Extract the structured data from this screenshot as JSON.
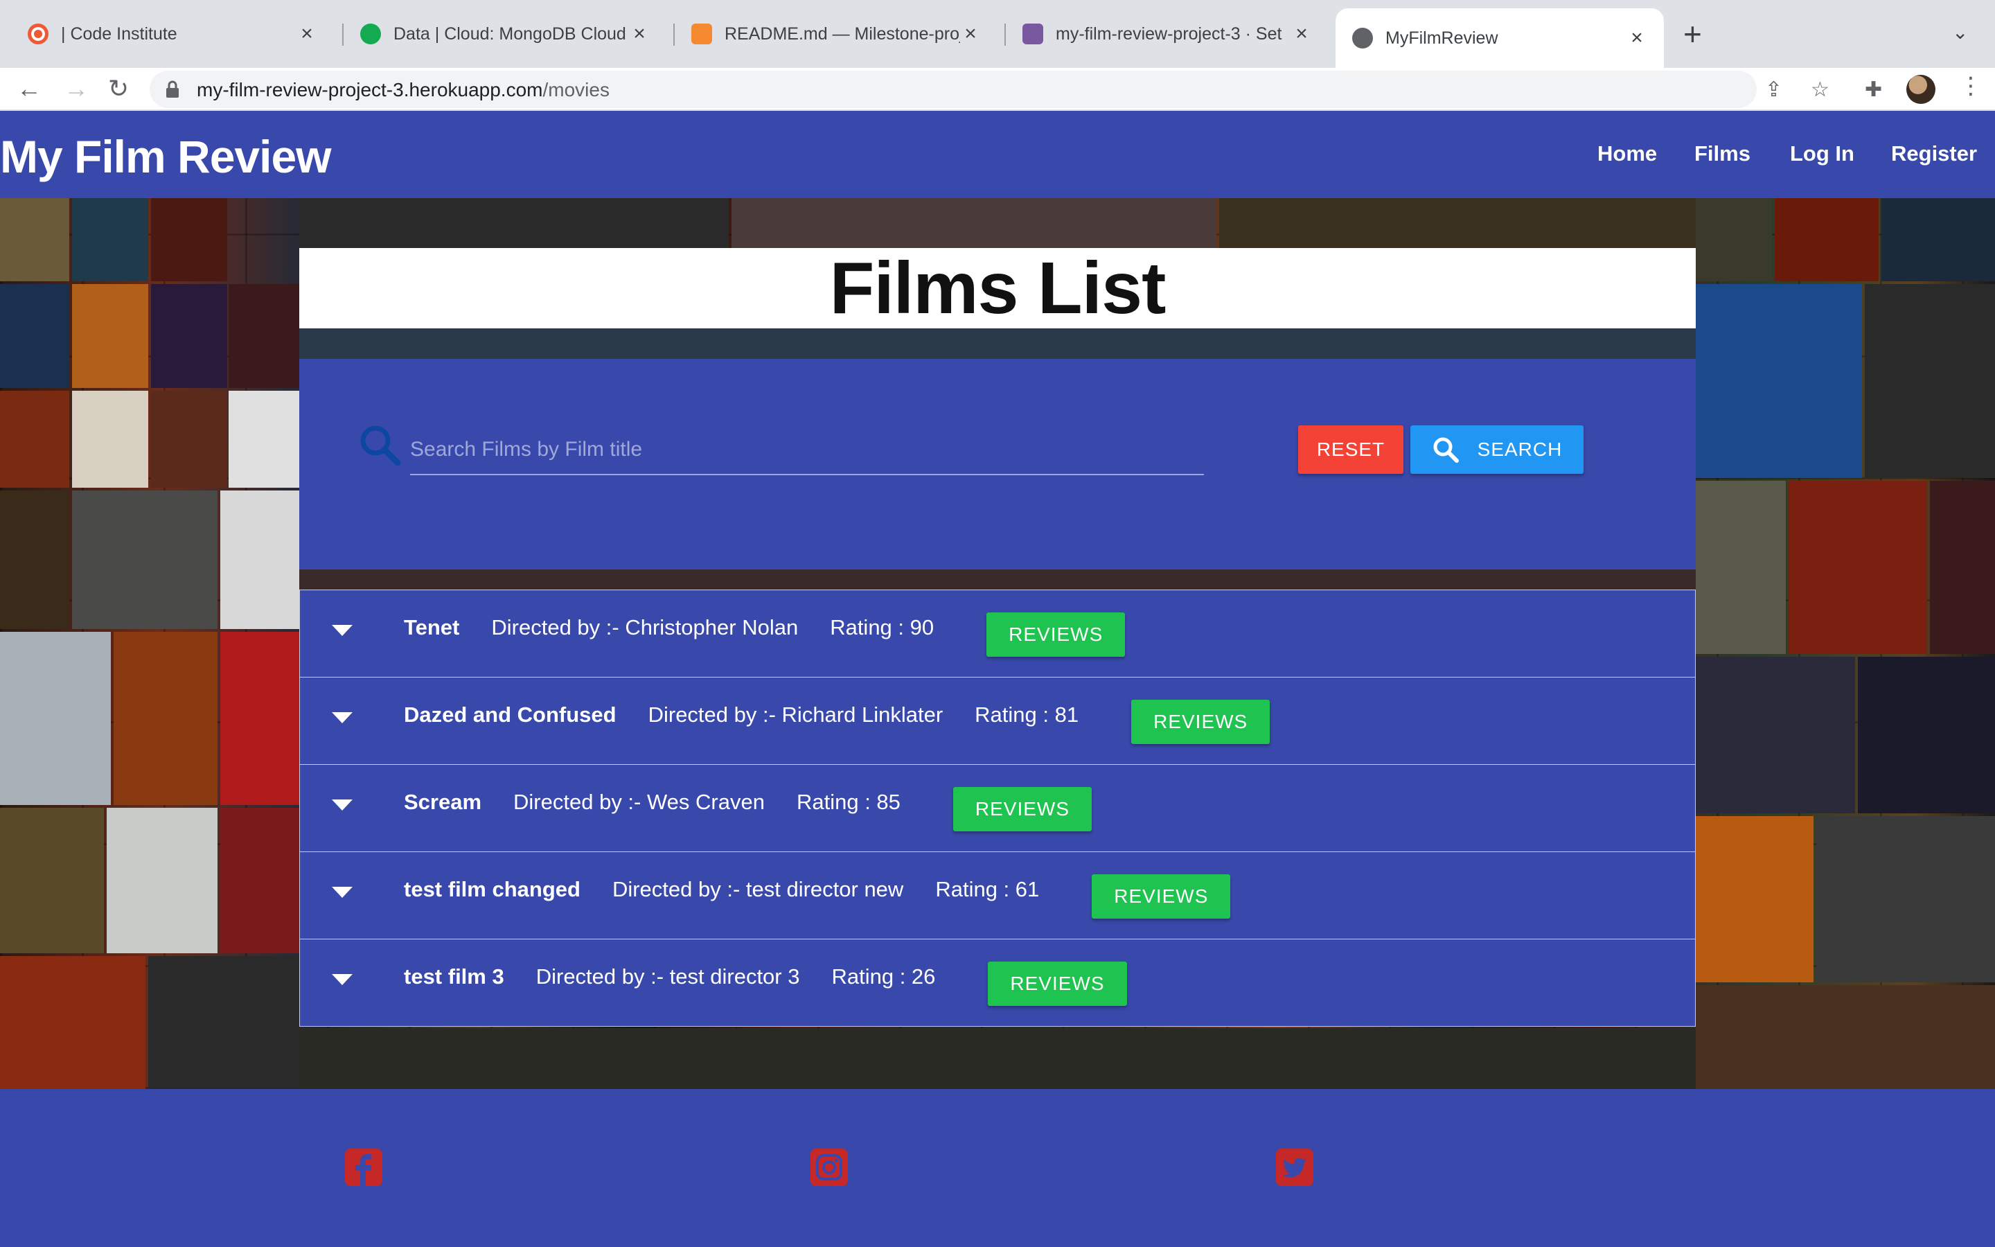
{
  "browser": {
    "tabs": [
      {
        "title": "| Code Institute",
        "active": false
      },
      {
        "title": "Data | Cloud: MongoDB Cloud",
        "active": false
      },
      {
        "title": "README.md — Milestone-proje",
        "active": false
      },
      {
        "title": "my-film-review-project-3 · Set",
        "active": false
      },
      {
        "title": "MyFilmReview",
        "active": true
      }
    ],
    "url_host": "my-film-review-project-3.herokuapp.com",
    "url_path": "/movies"
  },
  "site": {
    "brand": "My Film Review",
    "nav": {
      "home": "Home",
      "films": "Films",
      "login": "Log In",
      "register": "Register"
    }
  },
  "page": {
    "title": "Films List",
    "search": {
      "placeholder": "Search Films by Film title",
      "value": ""
    },
    "reset_label": "RESET",
    "search_label": "SEARCH",
    "films": [
      {
        "name": "Tenet",
        "director": "Directed by :- Christopher Nolan",
        "rating": "Rating : 90",
        "reviews_label": "REVIEWS"
      },
      {
        "name": "Dazed and Confused",
        "director": "Directed by :- Richard Linklater",
        "rating": "Rating : 81",
        "reviews_label": "REVIEWS"
      },
      {
        "name": "Scream",
        "director": "Directed by :- Wes Craven",
        "rating": "Rating : 85",
        "reviews_label": "REVIEWS"
      },
      {
        "name": "test film changed",
        "director": "Directed by :- test director new",
        "rating": "Rating : 61",
        "reviews_label": "REVIEWS"
      },
      {
        "name": "test film 3",
        "director": "Directed by :- test director 3",
        "rating": "Rating : 26",
        "reviews_label": "REVIEWS"
      }
    ]
  },
  "footer": {
    "icons": [
      "facebook-icon",
      "instagram-icon",
      "twitter-icon"
    ]
  },
  "colors": {
    "primary": "#3949ab",
    "reset": "#f44336",
    "search": "#2196f3",
    "reviews": "#1ec350",
    "social": "#c62828"
  }
}
